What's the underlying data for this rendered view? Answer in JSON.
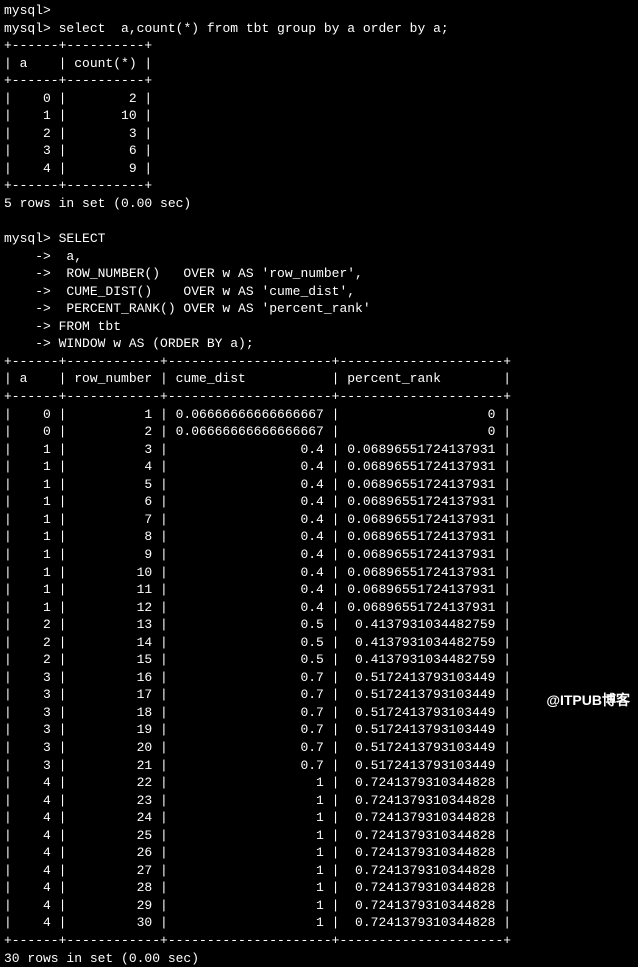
{
  "prompt1": "mysql>",
  "query1": "select  a,count(*) from tbt group by a order by a;",
  "table1": {
    "sep": "+------+----------+",
    "header": "| a    | count(*) |",
    "rows": [
      "|    0 |        2 |",
      "|    1 |       10 |",
      "|    2 |        3 |",
      "|    3 |        6 |",
      "|    4 |        9 |"
    ]
  },
  "result1": "5 rows in set (0.00 sec)",
  "query2": {
    "l1": "mysql> SELECT",
    "l2": "    ->  a,",
    "l3": "    ->  ROW_NUMBER()   OVER w AS 'row_number',",
    "l4": "    ->  CUME_DIST()    OVER w AS 'cume_dist',",
    "l5": "    ->  PERCENT_RANK() OVER w AS 'percent_rank'",
    "l6": "    -> FROM tbt",
    "l7": "    -> WINDOW w AS (ORDER BY a);"
  },
  "table2": {
    "sep": "+------+------------+---------------------+---------------------+",
    "header": "| a    | row_number | cume_dist           | percent_rank        |",
    "rows": [
      "|    0 |          1 | 0.06666666666666667 |                   0 |",
      "|    0 |          2 | 0.06666666666666667 |                   0 |",
      "|    1 |          3 |                 0.4 | 0.06896551724137931 |",
      "|    1 |          4 |                 0.4 | 0.06896551724137931 |",
      "|    1 |          5 |                 0.4 | 0.06896551724137931 |",
      "|    1 |          6 |                 0.4 | 0.06896551724137931 |",
      "|    1 |          7 |                 0.4 | 0.06896551724137931 |",
      "|    1 |          8 |                 0.4 | 0.06896551724137931 |",
      "|    1 |          9 |                 0.4 | 0.06896551724137931 |",
      "|    1 |         10 |                 0.4 | 0.06896551724137931 |",
      "|    1 |         11 |                 0.4 | 0.06896551724137931 |",
      "|    1 |         12 |                 0.4 | 0.06896551724137931 |",
      "|    2 |         13 |                 0.5 |  0.4137931034482759 |",
      "|    2 |         14 |                 0.5 |  0.4137931034482759 |",
      "|    2 |         15 |                 0.5 |  0.4137931034482759 |",
      "|    3 |         16 |                 0.7 |  0.5172413793103449 |",
      "|    3 |         17 |                 0.7 |  0.5172413793103449 |",
      "|    3 |         18 |                 0.7 |  0.5172413793103449 |",
      "|    3 |         19 |                 0.7 |  0.5172413793103449 |",
      "|    3 |         20 |                 0.7 |  0.5172413793103449 |",
      "|    3 |         21 |                 0.7 |  0.5172413793103449 |",
      "|    4 |         22 |                   1 |  0.7241379310344828 |",
      "|    4 |         23 |                   1 |  0.7241379310344828 |",
      "|    4 |         24 |                   1 |  0.7241379310344828 |",
      "|    4 |         25 |                   1 |  0.7241379310344828 |",
      "|    4 |         26 |                   1 |  0.7241379310344828 |",
      "|    4 |         27 |                   1 |  0.7241379310344828 |",
      "|    4 |         28 |                   1 |  0.7241379310344828 |",
      "|    4 |         29 |                   1 |  0.7241379310344828 |",
      "|    4 |         30 |                   1 |  0.7241379310344828 |"
    ]
  },
  "result2": "30 rows in set (0.00 sec)",
  "watermark": "@ITPUB博客",
  "chart_data": {
    "type": "table",
    "tables": [
      {
        "title": "select a,count(*) from tbt group by a order by a",
        "columns": [
          "a",
          "count(*)"
        ],
        "rows": [
          [
            0,
            2
          ],
          [
            1,
            10
          ],
          [
            2,
            3
          ],
          [
            3,
            6
          ],
          [
            4,
            9
          ]
        ]
      },
      {
        "title": "ROW_NUMBER / CUME_DIST / PERCENT_RANK OVER (ORDER BY a)",
        "columns": [
          "a",
          "row_number",
          "cume_dist",
          "percent_rank"
        ],
        "rows": [
          [
            0,
            1,
            0.06666666666666667,
            0
          ],
          [
            0,
            2,
            0.06666666666666667,
            0
          ],
          [
            1,
            3,
            0.4,
            0.06896551724137931
          ],
          [
            1,
            4,
            0.4,
            0.06896551724137931
          ],
          [
            1,
            5,
            0.4,
            0.06896551724137931
          ],
          [
            1,
            6,
            0.4,
            0.06896551724137931
          ],
          [
            1,
            7,
            0.4,
            0.06896551724137931
          ],
          [
            1,
            8,
            0.4,
            0.06896551724137931
          ],
          [
            1,
            9,
            0.4,
            0.06896551724137931
          ],
          [
            1,
            10,
            0.4,
            0.06896551724137931
          ],
          [
            1,
            11,
            0.4,
            0.06896551724137931
          ],
          [
            1,
            12,
            0.4,
            0.06896551724137931
          ],
          [
            2,
            13,
            0.5,
            0.4137931034482759
          ],
          [
            2,
            14,
            0.5,
            0.4137931034482759
          ],
          [
            2,
            15,
            0.5,
            0.4137931034482759
          ],
          [
            3,
            16,
            0.7,
            0.5172413793103449
          ],
          [
            3,
            17,
            0.7,
            0.5172413793103449
          ],
          [
            3,
            18,
            0.7,
            0.5172413793103449
          ],
          [
            3,
            19,
            0.7,
            0.5172413793103449
          ],
          [
            3,
            20,
            0.7,
            0.5172413793103449
          ],
          [
            3,
            21,
            0.7,
            0.5172413793103449
          ],
          [
            4,
            22,
            1,
            0.7241379310344828
          ],
          [
            4,
            23,
            1,
            0.7241379310344828
          ],
          [
            4,
            24,
            1,
            0.7241379310344828
          ],
          [
            4,
            25,
            1,
            0.7241379310344828
          ],
          [
            4,
            26,
            1,
            0.7241379310344828
          ],
          [
            4,
            27,
            1,
            0.7241379310344828
          ],
          [
            4,
            28,
            1,
            0.7241379310344828
          ],
          [
            4,
            29,
            1,
            0.7241379310344828
          ],
          [
            4,
            30,
            1,
            0.7241379310344828
          ]
        ]
      }
    ]
  }
}
